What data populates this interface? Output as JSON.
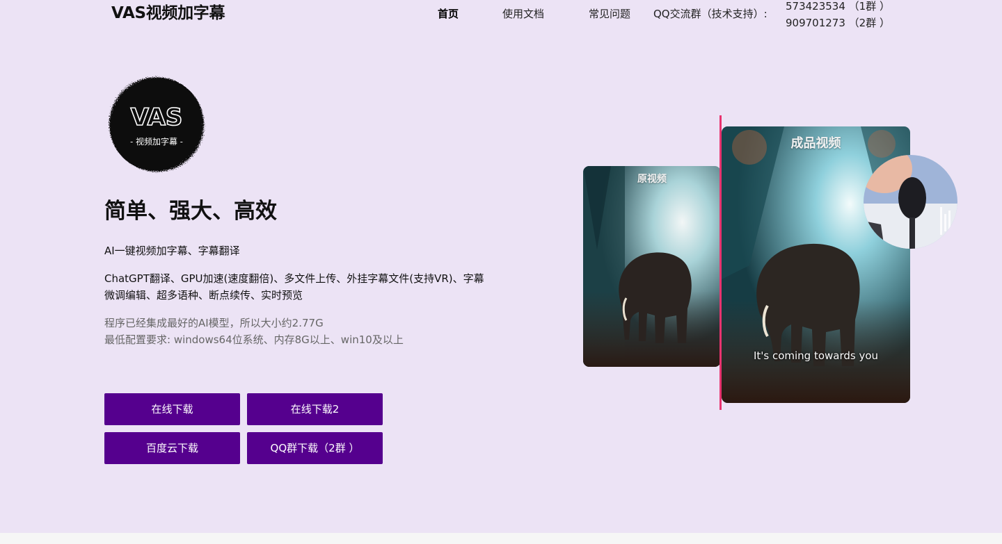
{
  "header": {
    "brand": "VAS视频加字幕",
    "nav": [
      {
        "label": "首页",
        "active": true
      },
      {
        "label": "使用文档",
        "active": false
      },
      {
        "label": "常见问题",
        "active": false
      }
    ],
    "qq_label": "QQ交流群（技术支持）:",
    "qq_groups": [
      "573423534 （1群 ）",
      "909701273 （2群 ）"
    ]
  },
  "hero": {
    "logo": {
      "title": "VAS",
      "subtitle": "- 视频加字幕 -"
    },
    "title": "简单、强大、高效",
    "subtitle": "AI一键视频加字幕、字幕翻译",
    "features": "ChatGPT翻译、GPU加速(速度翻倍)、多文件上传、外挂字幕文件(支持VR)、字幕微调编辑、超多语种、断点续传、实时预览",
    "note_lines": [
      "程序已经集成最好的AI模型，所以大小约2.77G",
      "最低配置要求: windows64位系统、内存8G以上、win10及以上"
    ],
    "buttons": {
      "online_download": "在线下载",
      "online_download_2": "在线下载2",
      "baidu_download": "百度云下载",
      "qq_download": "QQ群下载（2群 ）"
    }
  },
  "illustration": {
    "original_label": "原视频",
    "final_label": "成品视频",
    "subtitle_text": "It's coming towards you"
  },
  "colors": {
    "background": "#ece3f5",
    "button": "#55008e",
    "divider": "#e8336f"
  }
}
